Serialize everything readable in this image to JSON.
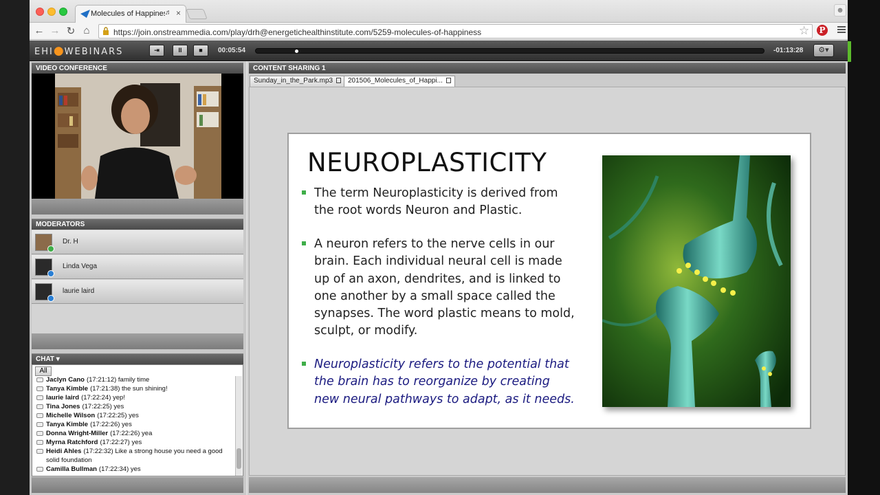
{
  "browser": {
    "tab_title": "Molecules of Happiness",
    "url": "https://join.onstreammedia.com/play/drh@energetichealthinstitute.com/5259-molecules-of-happiness"
  },
  "player": {
    "logo_prefix": "EHI",
    "logo_suffix": "WEBINARS",
    "elapsed": "00:05:54",
    "remaining": "-01:13:28",
    "progress_fraction": 0.078
  },
  "panels": {
    "video_conference": "VIDEO CONFERENCE",
    "content_sharing": "CONTENT SHARING 1",
    "moderators": "MODERATORS",
    "chat": "CHAT ▾"
  },
  "moderators": [
    {
      "name": "Dr. H"
    },
    {
      "name": "Linda Vega"
    },
    {
      "name": "laurie laird"
    }
  ],
  "chat": {
    "filter_tab": "All",
    "messages": [
      {
        "user": "Jaclyn Cano",
        "time": "(17:21:12)",
        "text": "family time"
      },
      {
        "user": "Tanya Kimble",
        "time": "(17:21:38)",
        "text": "the sun shining!"
      },
      {
        "user": "laurie laird",
        "time": "(17:22:24)",
        "text": "yep!"
      },
      {
        "user": "Tina Jones",
        "time": "(17:22:25)",
        "text": "yes"
      },
      {
        "user": "Michelle Wilson",
        "time": "(17:22:25)",
        "text": "yes"
      },
      {
        "user": "Tanya Kimble",
        "time": "(17:22:26)",
        "text": "yes"
      },
      {
        "user": "Donna Wright-Miller",
        "time": "(17:22:26)",
        "text": "yea"
      },
      {
        "user": "Myrna  Ratchford",
        "time": "(17:22:27)",
        "text": "yes"
      },
      {
        "user": "Heidi Ahles",
        "time": "(17:22:32)",
        "text": "Like a strong house you need a good solid foundation"
      },
      {
        "user": "Camilla Bullman",
        "time": "(17:22:34)",
        "text": "yes"
      }
    ]
  },
  "files": [
    {
      "label": "Sunday_in_the_Park.mp3"
    },
    {
      "label": "201506_Molecules_of_Happi..."
    }
  ],
  "slide": {
    "title": "NEUROPLASTICITY",
    "bullets": [
      "The term Neuroplasticity is derived from the root words Neuron and Plastic.",
      "A neuron refers to the nerve cells in our brain. Each individual neural cell is made up of an axon, dendrites, and is linked to one another by a small space called the synapses. The word plastic means to mold, sculpt, or modify.",
      "Neuroplasticity refers to the potential that the brain has to reorganize by creating new neural pathways to adapt, as it needs."
    ]
  },
  "colors": {
    "bullet_green": "#3fae49",
    "italic_blue": "#1b1b80",
    "logo_orange": "#f7941d"
  }
}
